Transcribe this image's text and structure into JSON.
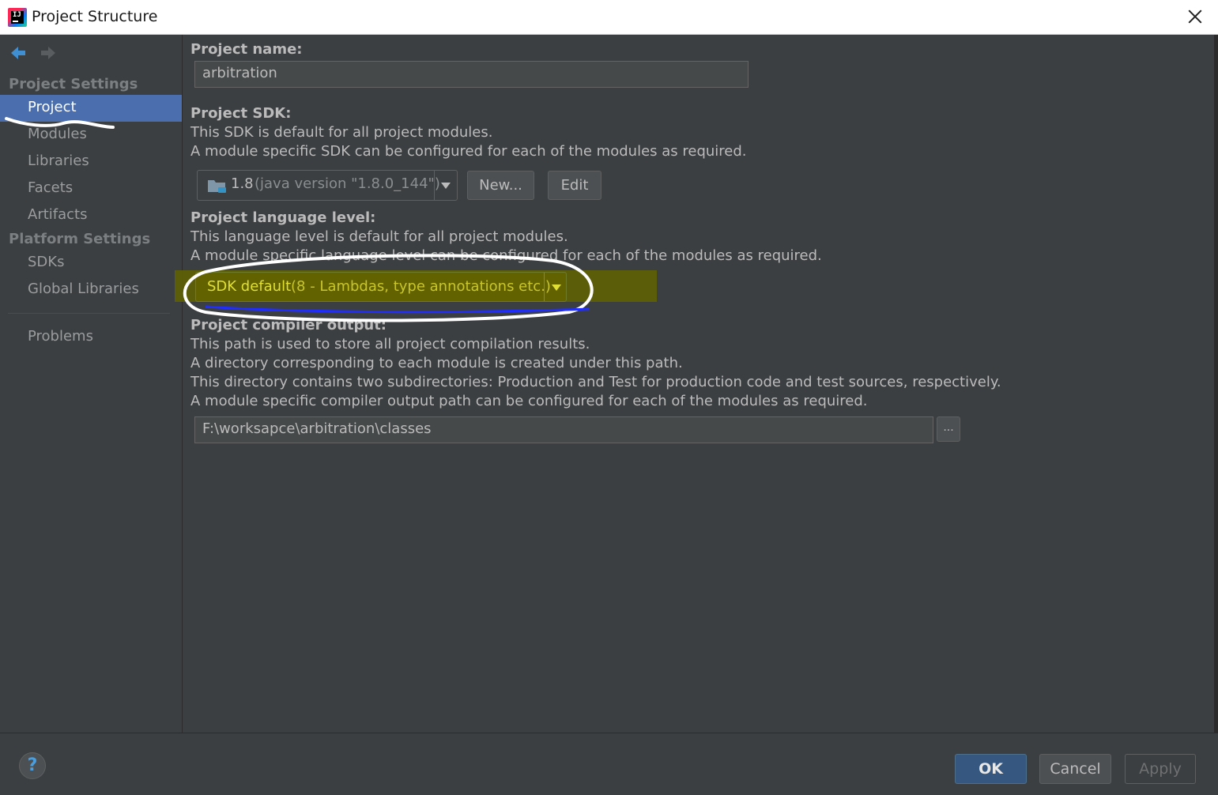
{
  "window": {
    "title": "Project Structure"
  },
  "sidebar": {
    "project_settings_header": "Project Settings",
    "project_items": [
      {
        "label": "Project"
      },
      {
        "label": "Modules"
      },
      {
        "label": "Libraries"
      },
      {
        "label": "Facets"
      },
      {
        "label": "Artifacts"
      }
    ],
    "platform_settings_header": "Platform Settings",
    "platform_items": [
      {
        "label": "SDKs"
      },
      {
        "label": "Global Libraries"
      }
    ],
    "problems_label": "Problems",
    "selected": "Project"
  },
  "main": {
    "project_name": {
      "label": "Project name:",
      "value": "arbitration"
    },
    "project_sdk": {
      "label": "Project SDK:",
      "desc_1": "This SDK is default for all project modules.",
      "desc_2": "A module specific SDK can be configured for each of the modules as required.",
      "sdk_name": "1.8",
      "sdk_version": "(java version \"1.8.0_144\")",
      "new_button": "New...",
      "edit_button": "Edit"
    },
    "language_level": {
      "label": "Project language level:",
      "desc_1": "This language level is default for all project modules.",
      "desc_2": "A module specific language level can be configured for each of the modules as required.",
      "value_main": "SDK default",
      "value_detail": "(8 - Lambdas, type annotations etc.)"
    },
    "compiler_output": {
      "label": "Project compiler output:",
      "desc_1": "This path is used to store all project compilation results.",
      "desc_2": "A directory corresponding to each module is created under this path.",
      "desc_3": "This directory contains two subdirectories: Production and Test for production code and test sources, respectively.",
      "desc_4": "A module specific compiler output path can be configured for each of the modules as required.",
      "path": "F:\\worksapce\\arbitration\\classes",
      "browse_button": "..."
    }
  },
  "footer": {
    "help_label": "?",
    "ok_label": "OK",
    "cancel_label": "Cancel",
    "apply_label": "Apply"
  },
  "colors": {
    "background": "#3c3f41",
    "selection": "#4b6eaf",
    "highlight": "#6b6b00",
    "highlight_text": "#d7d72a",
    "annotation_white": "#ffffff",
    "annotation_blue": "#1f2dff"
  },
  "icons": [
    "back-arrow-icon",
    "forward-arrow-icon",
    "folder-icon",
    "dropdown-arrow-icon",
    "close-icon",
    "help-icon",
    "app-logo-icon"
  ]
}
